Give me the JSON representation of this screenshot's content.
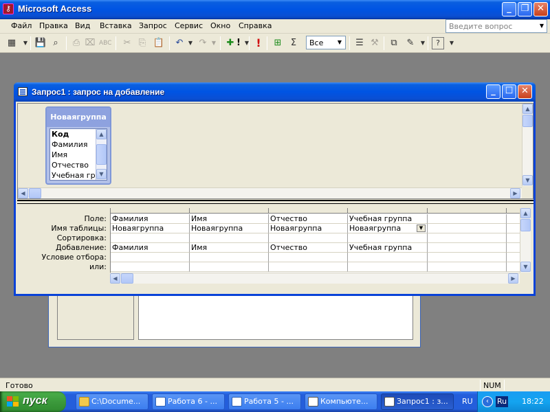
{
  "app": {
    "title": "Microsoft Access",
    "icon": "access-key-icon"
  },
  "menu": {
    "items": [
      "Файл",
      "Правка",
      "Вид",
      "Вставка",
      "Запрос",
      "Сервис",
      "Окно",
      "Справка"
    ],
    "ask_placeholder": "Введите вопрос"
  },
  "toolbar": {
    "top_values_combo": "Все",
    "sigma": "Σ",
    "run": "!"
  },
  "query_window": {
    "title": "Запрос1 : запрос на добавление"
  },
  "field_list": {
    "table": "Новаягруппа",
    "fields": [
      "Код",
      "Фамилия",
      "Имя",
      "Отчество",
      "Учебная груп"
    ]
  },
  "grid": {
    "row_labels": [
      "Поле:",
      "Имя таблицы:",
      "Сортировка:",
      "Добавление:",
      "Условие отбора:",
      "или:"
    ],
    "columns": [
      {
        "field": "Фамилия",
        "table": "Новаягруппа",
        "sort": "",
        "append_to": "Фамилия",
        "criteria": "",
        "or": ""
      },
      {
        "field": "Имя",
        "table": "Новаягруппа",
        "sort": "",
        "append_to": "Имя",
        "criteria": "",
        "or": ""
      },
      {
        "field": "Отчество",
        "table": "Новаягруппа",
        "sort": "",
        "append_to": "Отчество",
        "criteria": "",
        "or": ""
      },
      {
        "field": "Учебная группа",
        "table": "Новаягруппа",
        "sort": "",
        "append_to": "Учебная группа",
        "criteria": "",
        "or": ""
      },
      {
        "field": "",
        "table": "",
        "sort": "",
        "append_to": "",
        "criteria": "",
        "or": ""
      },
      {
        "field": "",
        "table": "",
        "sort": "",
        "append_to": "",
        "criteria": "",
        "or": ""
      }
    ]
  },
  "status": {
    "text": "Готово",
    "num": "NUM"
  },
  "taskbar": {
    "start": "пуск",
    "buttons": [
      {
        "label": "C:\\Docume...",
        "icon": "folder-icon",
        "color": "#f2c94c"
      },
      {
        "label": "Работа 6 - ...",
        "icon": "word-icon",
        "color": "#2b5fb4"
      },
      {
        "label": "Работа 5 - ...",
        "icon": "word-icon",
        "color": "#2b5fb4"
      },
      {
        "label": "Компьюте...",
        "icon": "window-icon",
        "color": "#ffffff"
      },
      {
        "label": "Запрос1 : з...",
        "icon": "query-icon",
        "color": "#ffffff"
      }
    ],
    "lang": "RU",
    "tray_lang": "Ru",
    "clock": "18:22"
  },
  "colors": {
    "xp_blue": "#0054e3",
    "window_face": "#ece9d8",
    "workspace": "#808080",
    "start_green": "#3c9a3c"
  }
}
